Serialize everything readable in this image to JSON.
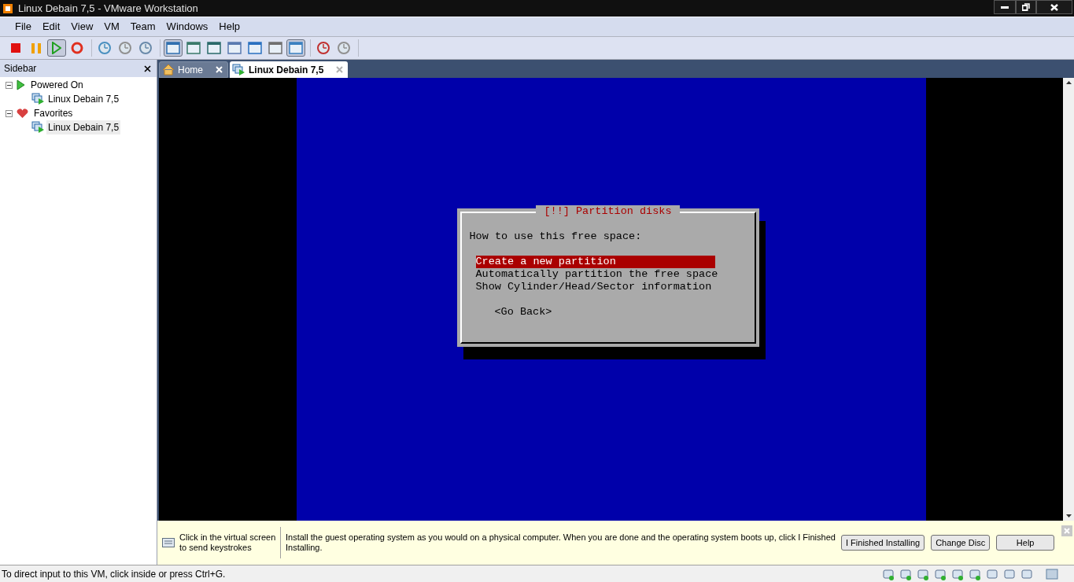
{
  "window": {
    "title": "Linux Debain 7,5 - VMware Workstation"
  },
  "menu": [
    "File",
    "Edit",
    "View",
    "VM",
    "Team",
    "Windows",
    "Help"
  ],
  "toolbar": {
    "groups": [
      [
        {
          "pressed": false
        },
        {
          "pressed": false
        },
        {
          "pressed": true
        },
        {
          "pressed": false
        }
      ],
      [
        {
          "pressed": false
        },
        {
          "pressed": false
        },
        {
          "pressed": false
        }
      ],
      [
        {
          "pressed": true
        },
        {
          "pressed": false
        },
        {
          "pressed": false
        },
        {
          "pressed": false
        },
        {
          "pressed": false
        },
        {
          "pressed": false
        },
        {
          "pressed": true
        }
      ],
      [
        {
          "pressed": false
        },
        {
          "pressed": false
        }
      ]
    ]
  },
  "sidebar": {
    "title": "Sidebar",
    "tree": [
      {
        "label": "Powered On",
        "kind": "powered",
        "expanded": true,
        "children": [
          {
            "label": "Linux Debain 7,5",
            "selected": false
          }
        ]
      },
      {
        "label": "Favorites",
        "kind": "favorites",
        "expanded": true,
        "children": [
          {
            "label": "Linux Debain 7,5",
            "selected": true
          }
        ]
      }
    ]
  },
  "tabs": [
    {
      "label": "Home",
      "kind": "home",
      "selected": false
    },
    {
      "label": "Linux Debain 7,5",
      "kind": "vm",
      "selected": true
    }
  ],
  "installer": {
    "title": "[!!] Partition disks",
    "prompt": "How to use this free space:",
    "options": [
      {
        "label": "Create a new partition",
        "selected": true
      },
      {
        "label": "Automatically partition the free space",
        "selected": false
      },
      {
        "label": "Show Cylinder/Head/Sector information",
        "selected": false
      }
    ],
    "button": "<Go Back>"
  },
  "info_bar": {
    "hint": "Click in the virtual screen to send keystrokes",
    "message": "Install the guest operating system as you would on a physical computer. When you are done and the operating system boots up, click I Finished Installing.",
    "buttons": [
      "I Finished Installing",
      "Change Disc",
      "Help"
    ]
  },
  "status_bar": {
    "text": "To direct input to this VM, click inside or press Ctrl+G."
  }
}
